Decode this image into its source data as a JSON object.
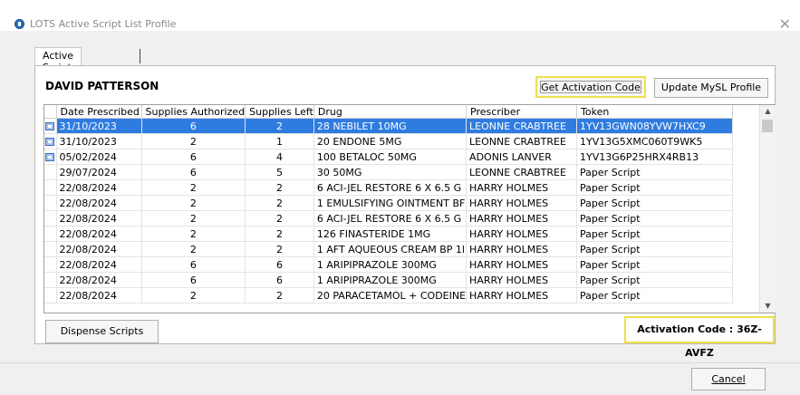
{
  "window": {
    "title": "LOTS Active Script List Profile",
    "close_glyph": "✕"
  },
  "tab": {
    "label": "Active Script List"
  },
  "patient": {
    "name": "DAVID PATTERSON"
  },
  "buttons": {
    "get_activation": "Get Activation Code",
    "update_profile": "Update MySL Profile",
    "dispense": "Dispense Scripts",
    "cancel": "Cancel"
  },
  "activation": {
    "text": "Activation Code : 36Z-AVFZ"
  },
  "table": {
    "headers": [
      "Date Prescribed",
      "Supplies Authorized",
      "Supplies Left",
      "Drug",
      "Prescriber",
      "Token"
    ],
    "rows": [
      {
        "icon": true,
        "selected": true,
        "cells": [
          "31/10/2023",
          "6",
          "2",
          "28 NEBILET 10MG",
          "LEONNE CRABTREE",
          "1YV13GWN08YVW7HXC9"
        ]
      },
      {
        "icon": true,
        "selected": false,
        "cells": [
          "31/10/2023",
          "2",
          "1",
          "20 ENDONE 5MG",
          "LEONNE CRABTREE",
          "1YV13G5XMC060T9WK5"
        ]
      },
      {
        "icon": true,
        "selected": false,
        "cells": [
          "05/02/2024",
          "6",
          "4",
          "100 BETALOC 50MG",
          "ADONIS LANVER",
          "1YV13G6P25HRX4RB13"
        ]
      },
      {
        "icon": false,
        "selected": false,
        "cells": [
          "29/07/2024",
          "6",
          "5",
          "30 50MG",
          "LEONNE CRABTREE",
          "Paper Script"
        ]
      },
      {
        "icon": false,
        "selected": false,
        "cells": [
          "22/08/2024",
          "2",
          "2",
          "6 ACI-JEL RESTORE 6 X 6.5 G",
          "HARRY HOLMES",
          "Paper Script"
        ]
      },
      {
        "icon": false,
        "selected": false,
        "cells": [
          "22/08/2024",
          "2",
          "2",
          "1 EMULSIFYING OINTMENT BF",
          "HARRY HOLMES",
          "Paper Script"
        ]
      },
      {
        "icon": false,
        "selected": false,
        "cells": [
          "22/08/2024",
          "2",
          "2",
          "6 ACI-JEL RESTORE 6 X 6.5 G",
          "HARRY HOLMES",
          "Paper Script"
        ]
      },
      {
        "icon": false,
        "selected": false,
        "cells": [
          "22/08/2024",
          "2",
          "2",
          "126 FINASTERIDE 1MG",
          "HARRY HOLMES",
          "Paper Script"
        ]
      },
      {
        "icon": false,
        "selected": false,
        "cells": [
          "22/08/2024",
          "2",
          "2",
          "1 AFT AQUEOUS CREAM BP 1l",
          "HARRY HOLMES",
          "Paper Script"
        ]
      },
      {
        "icon": false,
        "selected": false,
        "cells": [
          "22/08/2024",
          "6",
          "6",
          "1 ARIPIPRAZOLE 300MG",
          "HARRY HOLMES",
          "Paper Script"
        ]
      },
      {
        "icon": false,
        "selected": false,
        "cells": [
          "22/08/2024",
          "6",
          "6",
          "1 ARIPIPRAZOLE 300MG",
          "HARRY HOLMES",
          "Paper Script"
        ]
      },
      {
        "icon": false,
        "selected": false,
        "cells": [
          "22/08/2024",
          "2",
          "2",
          "20 PARACETAMOL + CODEINE",
          "HARRY HOLMES",
          "Paper Script"
        ]
      }
    ]
  },
  "scrollbar": {
    "up_glyph": "▲",
    "down_glyph": "▼"
  },
  "colors": {
    "selection": "#2f7ce0",
    "highlight_border": "#efe04a"
  }
}
